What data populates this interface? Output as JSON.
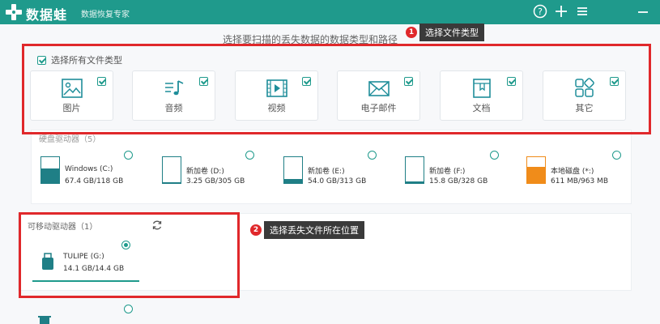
{
  "titlebar": {
    "app_name": "数据蛙",
    "app_sub": "数据恢复专家",
    "icons": [
      "help-icon",
      "plus-icon",
      "menu-icon",
      "minimize-icon"
    ]
  },
  "instruction": "选择要扫描的丢失数据的数据类型和路径",
  "select_all": "选择所有文件类型",
  "file_types": [
    {
      "label": "图片",
      "icon": "image-icon"
    },
    {
      "label": "音频",
      "icon": "audio-icon"
    },
    {
      "label": "视频",
      "icon": "video-icon"
    },
    {
      "label": "电子邮件",
      "icon": "email-icon"
    },
    {
      "label": "文档",
      "icon": "document-icon"
    },
    {
      "label": "其它",
      "icon": "other-icon"
    }
  ],
  "disk_section_title": "硬盘驱动器（5）",
  "disks": [
    {
      "name": "Windows (C:)",
      "size": "67.4 GB/118 GB",
      "fill": 0.57,
      "color": "#1f7f86"
    },
    {
      "name": "新加卷 (D:)",
      "size": "3.25 GB/305 GB",
      "fill": 0.01,
      "color": "#1f7f86"
    },
    {
      "name": "新加卷 (E:)",
      "size": "54.0 GB/313 GB",
      "fill": 0.17,
      "color": "#1f7f86"
    },
    {
      "name": "新加卷 (F:)",
      "size": "15.8 GB/328 GB",
      "fill": 0.05,
      "color": "#1f7f86"
    },
    {
      "name": "本地磁盘 (*:)",
      "size": "611 MB/963 MB",
      "fill": 0.63,
      "color": "#f08c1a"
    }
  ],
  "removable_title": "可移动驱动器（1）",
  "usb": {
    "name": "TULIPE (G:)",
    "size": "14.1 GB/14.4 GB"
  },
  "callout1": {
    "num": "1",
    "text": "选择文件类型"
  },
  "callout2": {
    "num": "2",
    "text": "选择丢失文件所在位置"
  }
}
